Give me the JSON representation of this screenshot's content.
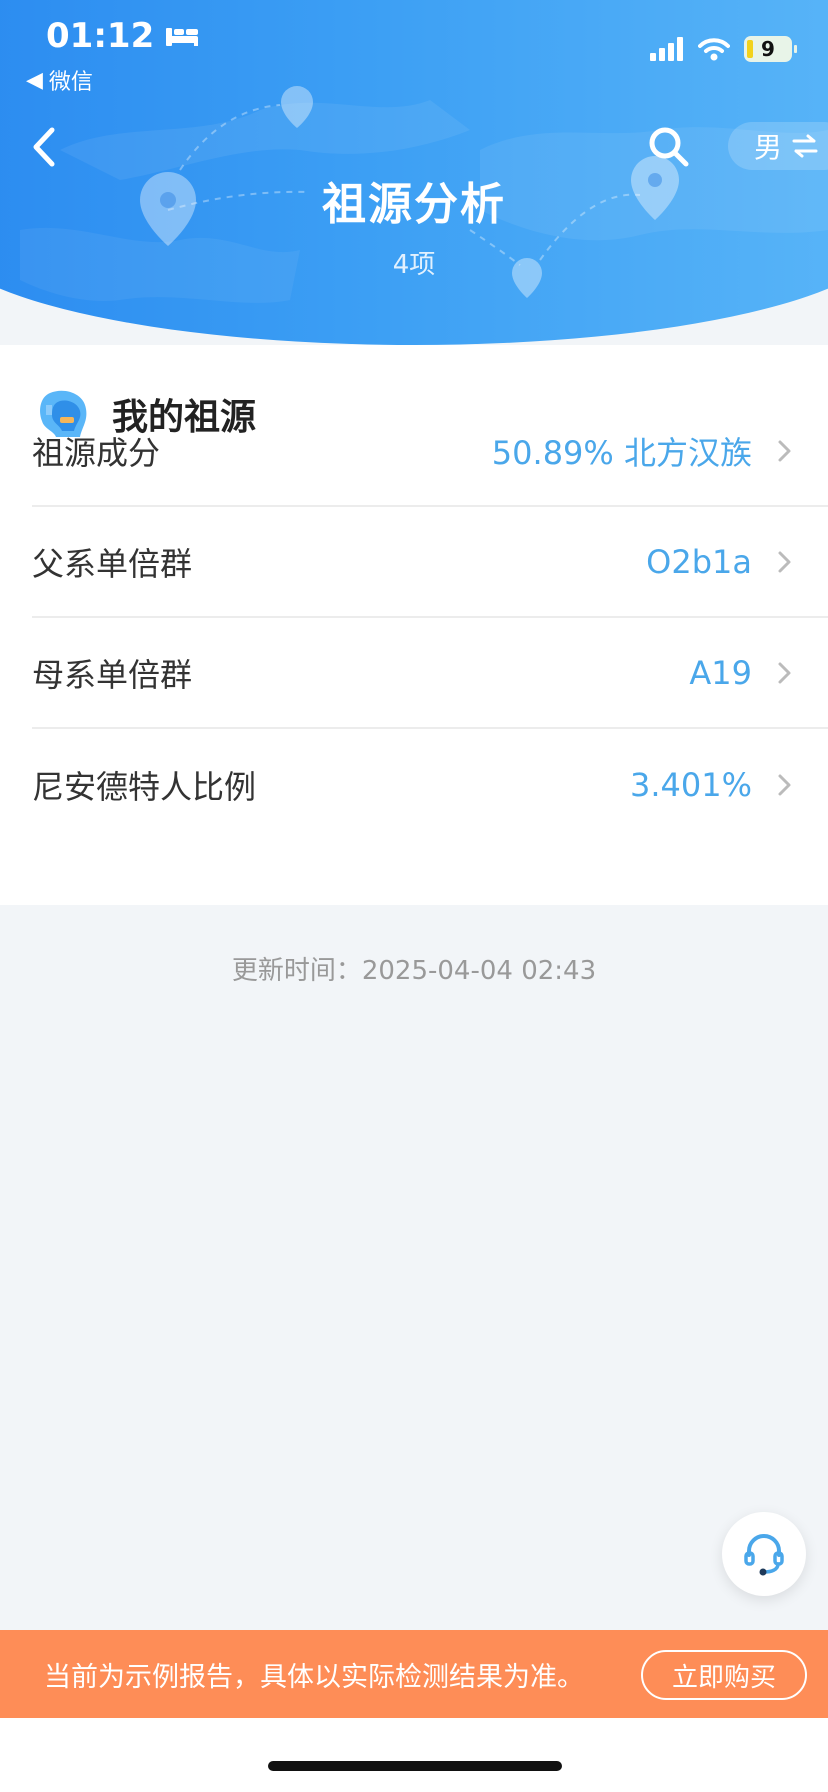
{
  "status_bar": {
    "time": "01:12",
    "back_app": "微信",
    "battery": "9"
  },
  "header": {
    "title": "祖源分析",
    "subtitle": "4项",
    "gender": "男"
  },
  "section": {
    "title": "我的祖源"
  },
  "rows": [
    {
      "label": "祖源成分",
      "value": "50.89% 北方汉族"
    },
    {
      "label": "父系单倍群",
      "value": "O2b1a"
    },
    {
      "label": "母系单倍群",
      "value": "A19"
    },
    {
      "label": "尼安德特人比例",
      "value": "3.401%"
    }
  ],
  "update_time": "更新时间：2025-04-04 02:43",
  "banner": {
    "text": "当前为示例报告，具体以实际检测结果为准。",
    "buy_label": "立即购买"
  },
  "colors": {
    "header_blue": "#3c9ff4",
    "value_blue": "#4aa7ea",
    "banner_orange": "#fe8d57"
  }
}
